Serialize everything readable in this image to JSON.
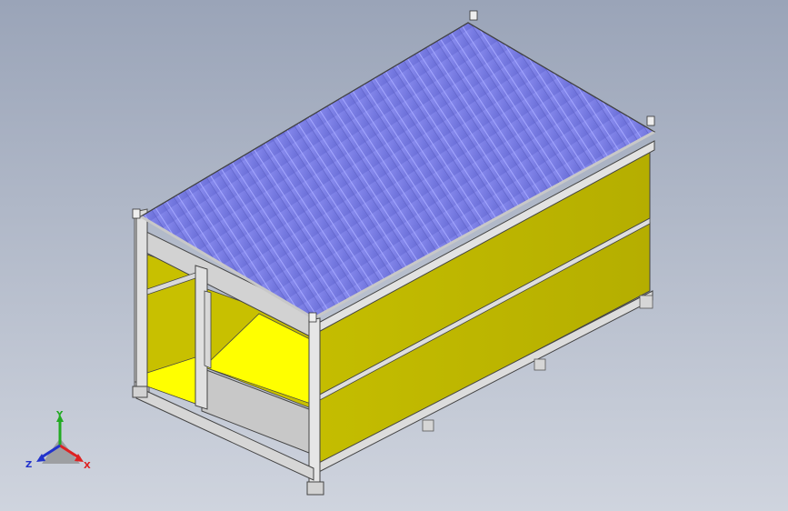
{
  "viewport": {
    "background_top": "#9aa4b8",
    "background_bottom": "#cfd4de"
  },
  "model": {
    "roof_color": "#7d80e8",
    "panel_color": "#c8c000",
    "floor_color": "#ffff00",
    "frame_color": "#d8d8d8"
  },
  "triad": {
    "y_label": "Y",
    "z_label": "Z",
    "x_label": "X",
    "y_color": "#22aa22",
    "z_color": "#2233cc",
    "x_color": "#dd2222"
  }
}
